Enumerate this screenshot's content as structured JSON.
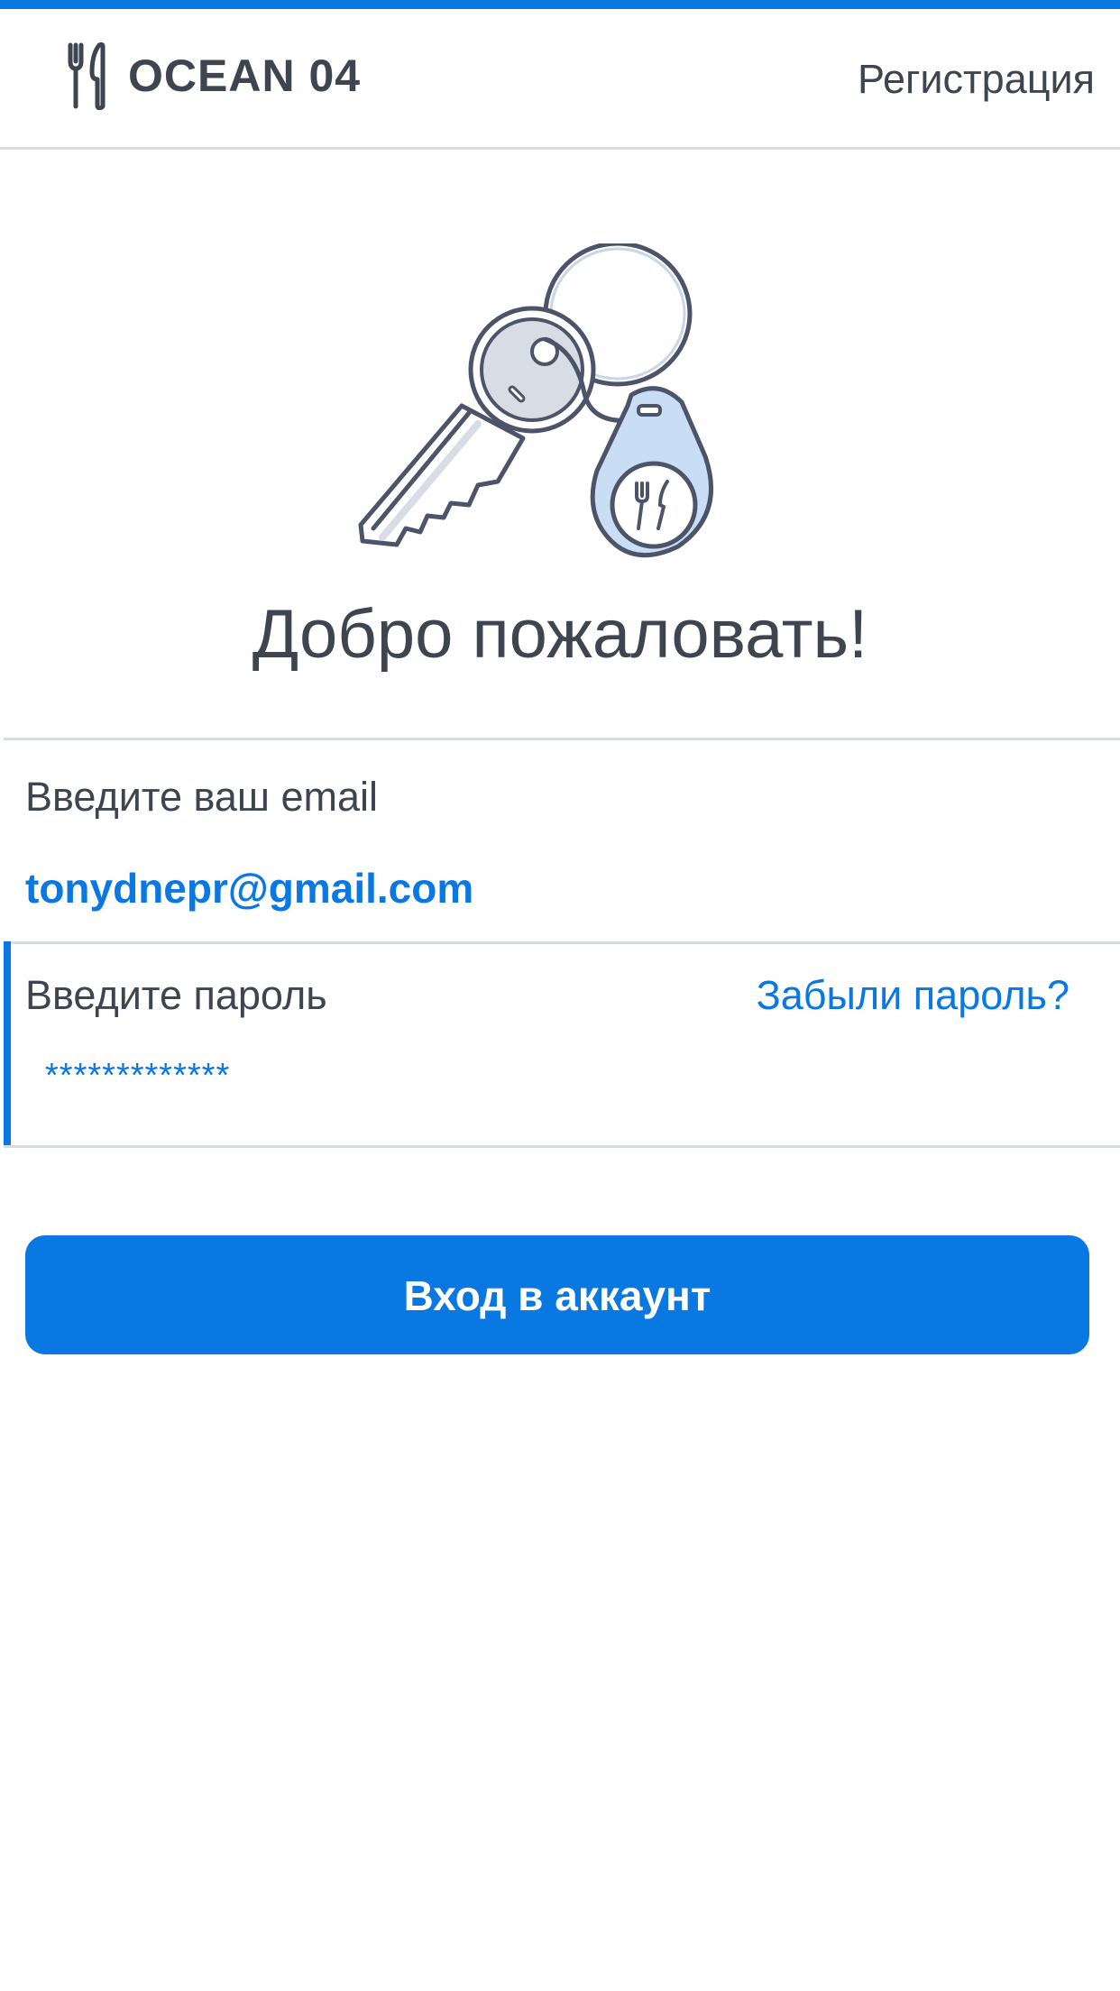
{
  "header": {
    "brand_name": "OCEAN 04",
    "register_label": "Регистрация"
  },
  "hero": {
    "icon": "keys-with-restaurant-tag-icon",
    "welcome_text": "Добро пожаловать!"
  },
  "form": {
    "email": {
      "label": "Введите ваш email",
      "value": "tonydnepr@gmail.com"
    },
    "password": {
      "label": "Введите пароль",
      "value": "*************",
      "forgot_label": "Забыли пароль?"
    },
    "submit_label": "Вход в аккаунт"
  },
  "colors": {
    "accent": "#0a78e3",
    "text": "#3d4650",
    "divider": "#d6dcdf"
  }
}
